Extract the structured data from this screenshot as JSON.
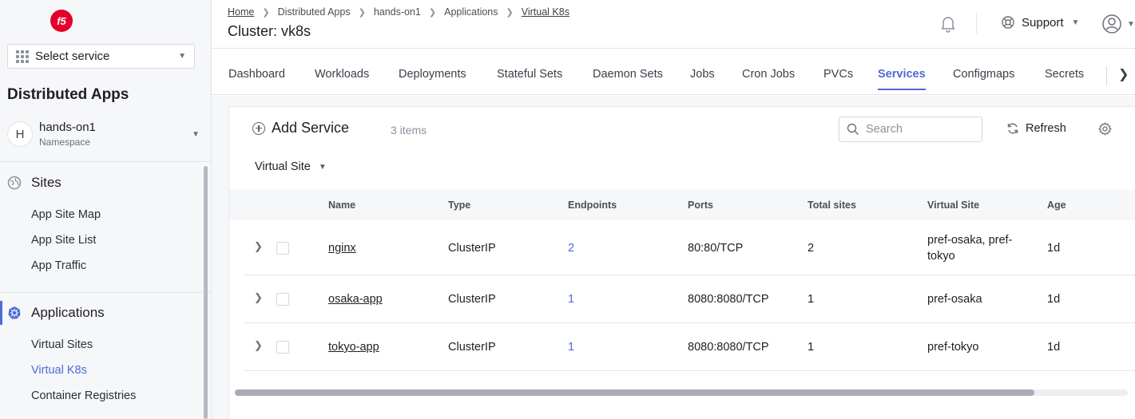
{
  "sidebar": {
    "logo_text": "f5",
    "service_selector": "Select service",
    "section_title": "Distributed Apps",
    "namespace": {
      "avatar": "H",
      "name": "hands-on1",
      "label": "Namespace"
    },
    "groups": [
      {
        "title": "Sites",
        "icon": "globe-icon",
        "items": [
          "App Site Map",
          "App Site List",
          "App Traffic"
        ]
      },
      {
        "title": "Applications",
        "icon": "kubernetes-icon",
        "items": [
          "Virtual Sites",
          "Virtual K8s",
          "Container Registries"
        ],
        "active_item": "Virtual K8s"
      }
    ]
  },
  "header": {
    "breadcrumb": [
      "Home",
      "Distributed Apps",
      "hands-on1",
      "Applications",
      "Virtual K8s"
    ],
    "title": "Cluster: vk8s",
    "support_label": "Support"
  },
  "tabs": {
    "items": [
      "Dashboard",
      "Workloads",
      "Deployments",
      "Stateful Sets",
      "Daemon Sets",
      "Jobs",
      "Cron Jobs",
      "PVCs",
      "Services",
      "Configmaps",
      "Secrets"
    ],
    "active": "Services"
  },
  "toolbar": {
    "add_label": "Add Service",
    "item_count": "3 items",
    "search_placeholder": "Search",
    "refresh_label": "Refresh",
    "filter_label": "Virtual Site"
  },
  "table": {
    "columns": [
      "Name",
      "Type",
      "Endpoints",
      "Ports",
      "Total sites",
      "Virtual Site",
      "Age"
    ],
    "rows": [
      {
        "name": "nginx",
        "type": "ClusterIP",
        "endpoints": "2",
        "ports": "80:80/TCP",
        "total_sites": "2",
        "virtual_site_line1": "pref-osaka, pref-",
        "virtual_site_line2": "tokyo",
        "age": "1d"
      },
      {
        "name": "osaka-app",
        "type": "ClusterIP",
        "endpoints": "1",
        "ports": "8080:8080/TCP",
        "total_sites": "1",
        "virtual_site_line1": "pref-osaka",
        "virtual_site_line2": "",
        "age": "1d"
      },
      {
        "name": "tokyo-app",
        "type": "ClusterIP",
        "endpoints": "1",
        "ports": "8080:8080/TCP",
        "total_sites": "1",
        "virtual_site_line1": "pref-tokyo",
        "virtual_site_line2": "",
        "age": "1d"
      }
    ]
  },
  "colors": {
    "accent": "#4d6ad8",
    "brand": "#e4002b"
  }
}
